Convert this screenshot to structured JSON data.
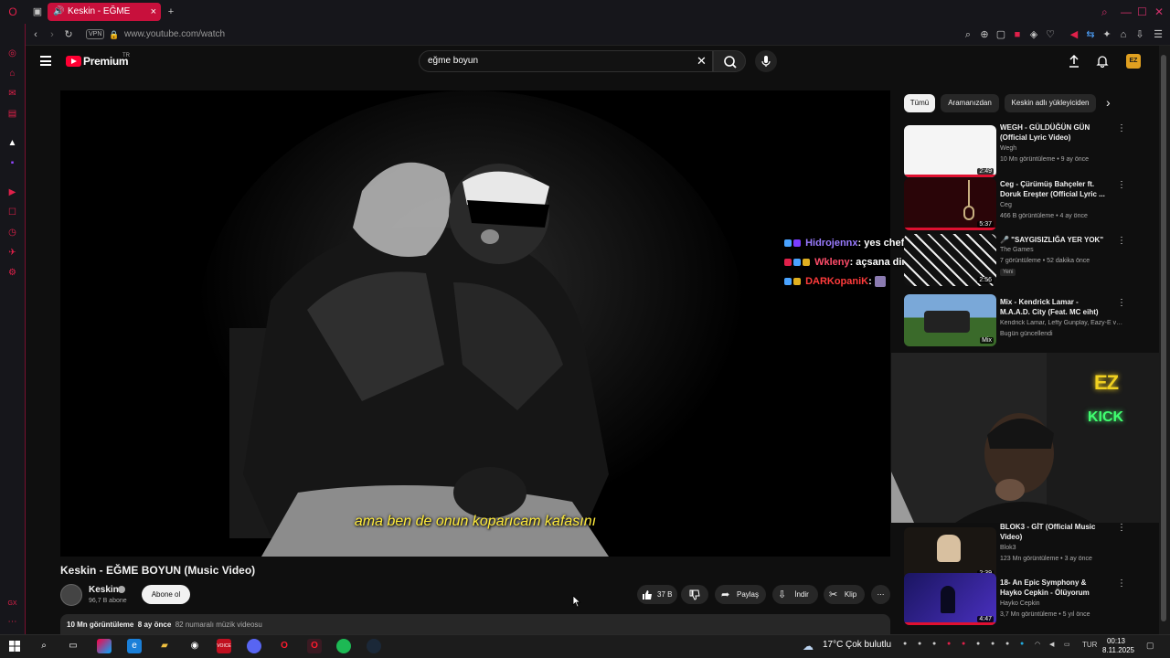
{
  "browser": {
    "tab_title": "Keskin - EĞME BOYUN",
    "url": "www.youtube.com/watch",
    "vpn_label": "VPN",
    "accent_color": "#c8103c"
  },
  "header": {
    "logo_text": "Premium",
    "logo_region": "TR",
    "search_value": "eğme boyun"
  },
  "video": {
    "caption": "ama ben de onun koparıcam kafasını",
    "title": "Keskin - EĞME BOYUN (Music Video)",
    "channel_name": "Keskin",
    "channel_subs": "96,7 B abone",
    "subscribe_label": "Abone ol",
    "like_count": "37 B",
    "share_label": "Paylaş",
    "download_label": "İndir",
    "clip_label": "Klip",
    "views": "10 Mn görüntüleme",
    "age": "8 ay önce",
    "tag": "82 numaralı müzik videosu"
  },
  "chat": [
    {
      "user": "Hidrojennx",
      "message": ": yes chef",
      "color": "#9a7cff"
    },
    {
      "user": "Wkleny",
      "message": ": açsana dinleyip yatçam",
      "color": "#ff4d6a"
    },
    {
      "user": "DARKopaniK",
      "message": ":",
      "color": "#ff3b3b"
    }
  ],
  "filters": [
    "Tümü",
    "Aramanızdan",
    "Keskin adlı yükleyiciden"
  ],
  "recommendations": [
    {
      "title": "WEGH - GÜLDÜĞÜN GÜN (Official Lyric Video)",
      "channel": "Wegh",
      "views": "10 Mn görüntüleme",
      "age": "9 ay önce",
      "duration": "2:49"
    },
    {
      "title": "Ceg - Çürümüş Bahçeler ft. Doruk Ereşter (Official Lyric ...",
      "channel": "Ceg",
      "views": "466 B görüntüleme",
      "age": "4 ay önce",
      "duration": "5:37"
    },
    {
      "title": "🎤 \"SAYGISIZLIĞA YER YOK\"",
      "channel": "The Games",
      "views": "7 görüntüleme",
      "age": "52 dakika önce",
      "duration": "2:56",
      "badge": "Yeni"
    },
    {
      "title": "Mix - Kendrick Lamar - M.A.A.D. City (Feat. MC eiht)",
      "channel": "Kendrick Lamar, Lefty Gunplay, Eazy-E ve...",
      "meta": "Bugün güncellendi",
      "duration": "Mix"
    },
    {
      "title": "BLOK3 - GİT (Official Music Video)",
      "channel": "Blok3",
      "views": "123 Mn görüntüleme",
      "age": "3 ay önce",
      "duration": "2:39"
    },
    {
      "title": "18- An Epic Symphony & Hayko Cepkin - Ölüyorum",
      "channel": "Hayko Cepkin",
      "views": "3,7 Mn görüntüleme",
      "age": "5 yıl önce",
      "duration": "4:47"
    }
  ],
  "webcam_sign": {
    "top": "EZ",
    "bottom": "KICK"
  },
  "taskbar": {
    "weather_temp": "17°C",
    "weather_text": "Çok bulutlu",
    "lang": "TUR",
    "time": "00:13",
    "date": "8.11.2025"
  }
}
